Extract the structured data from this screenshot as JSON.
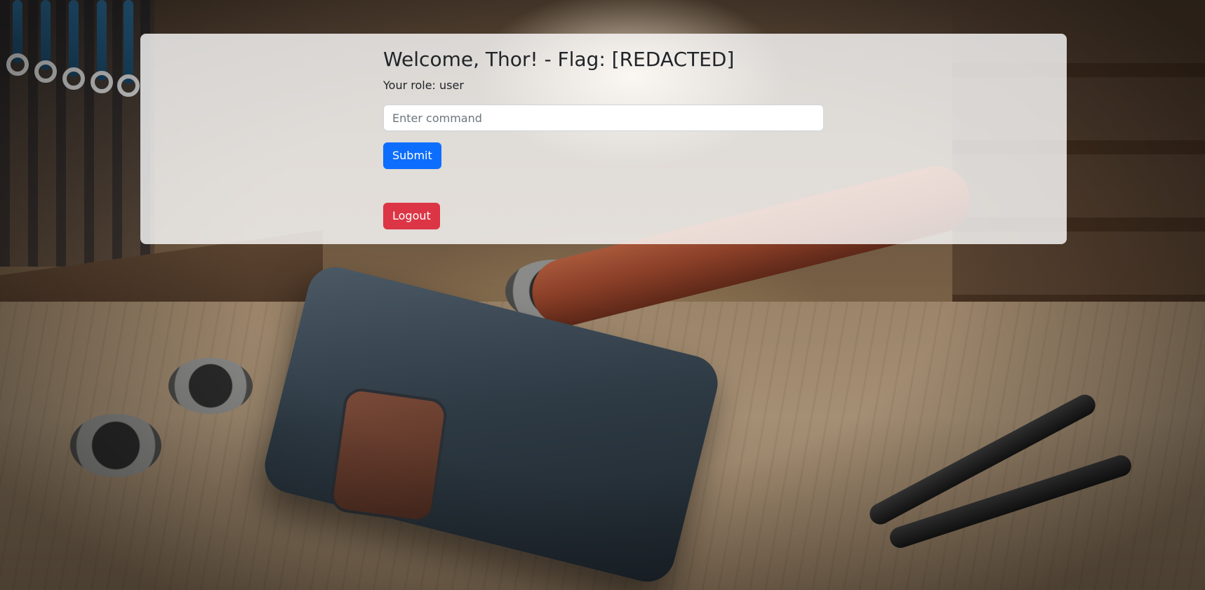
{
  "page": {
    "welcome_heading": "Welcome, Thor! - Flag: [REDACTED]",
    "role_text": "Your role: user"
  },
  "command_form": {
    "input_value": "",
    "input_placeholder": "Enter command",
    "submit_label": "Submit"
  },
  "actions": {
    "logout_label": "Logout"
  },
  "colors": {
    "primary": "#0d6efd",
    "danger": "#dc3545",
    "panel_background": "rgba(255,255,255,0.80)"
  },
  "background": {
    "description_icon": "workshop-hammer-background-image"
  }
}
